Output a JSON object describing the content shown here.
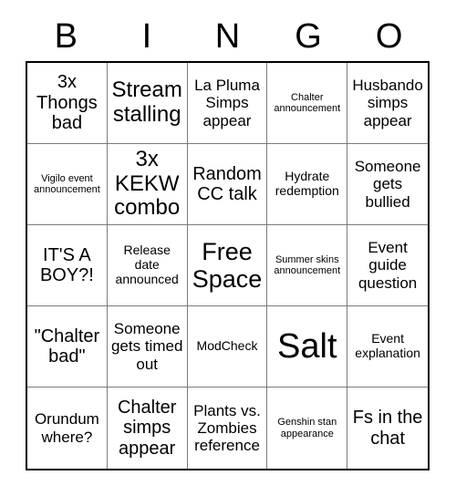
{
  "card": {
    "header_letters": [
      "B",
      "I",
      "N",
      "G",
      "O"
    ],
    "cells": [
      {
        "text": "3x Thongs bad",
        "size": "l"
      },
      {
        "text": "Stream stalling",
        "size": "xl"
      },
      {
        "text": "La Pluma Simps appear",
        "size": "m"
      },
      {
        "text": "Chalter announcement",
        "size": "xs"
      },
      {
        "text": "Husbando simps appear",
        "size": "m"
      },
      {
        "text": "Vigilo event announcement",
        "size": "xs"
      },
      {
        "text": "3x KEKW combo",
        "size": "xl"
      },
      {
        "text": "Random CC talk",
        "size": "l"
      },
      {
        "text": "Hydrate redemption",
        "size": "s"
      },
      {
        "text": "Someone gets bullied",
        "size": "m"
      },
      {
        "text": "IT'S A BOY?!",
        "size": "l"
      },
      {
        "text": "Release date announced",
        "size": "s"
      },
      {
        "text": "Free Space",
        "size": "xxl"
      },
      {
        "text": "Summer skins announcement",
        "size": "xs"
      },
      {
        "text": "Event guide question",
        "size": "m"
      },
      {
        "text": "\"Chalter bad\"",
        "size": "l"
      },
      {
        "text": "Someone gets timed out",
        "size": "m"
      },
      {
        "text": "ModCheck",
        "size": "s"
      },
      {
        "text": "Salt",
        "size": "huge"
      },
      {
        "text": "Event explanation",
        "size": "s"
      },
      {
        "text": "Orundum where?",
        "size": "m"
      },
      {
        "text": "Chalter simps appear",
        "size": "l"
      },
      {
        "text": "Plants vs. Zombies reference",
        "size": "m"
      },
      {
        "text": "Genshin stan appearance",
        "size": "xs"
      },
      {
        "text": "Fs in the chat",
        "size": "l"
      }
    ]
  }
}
